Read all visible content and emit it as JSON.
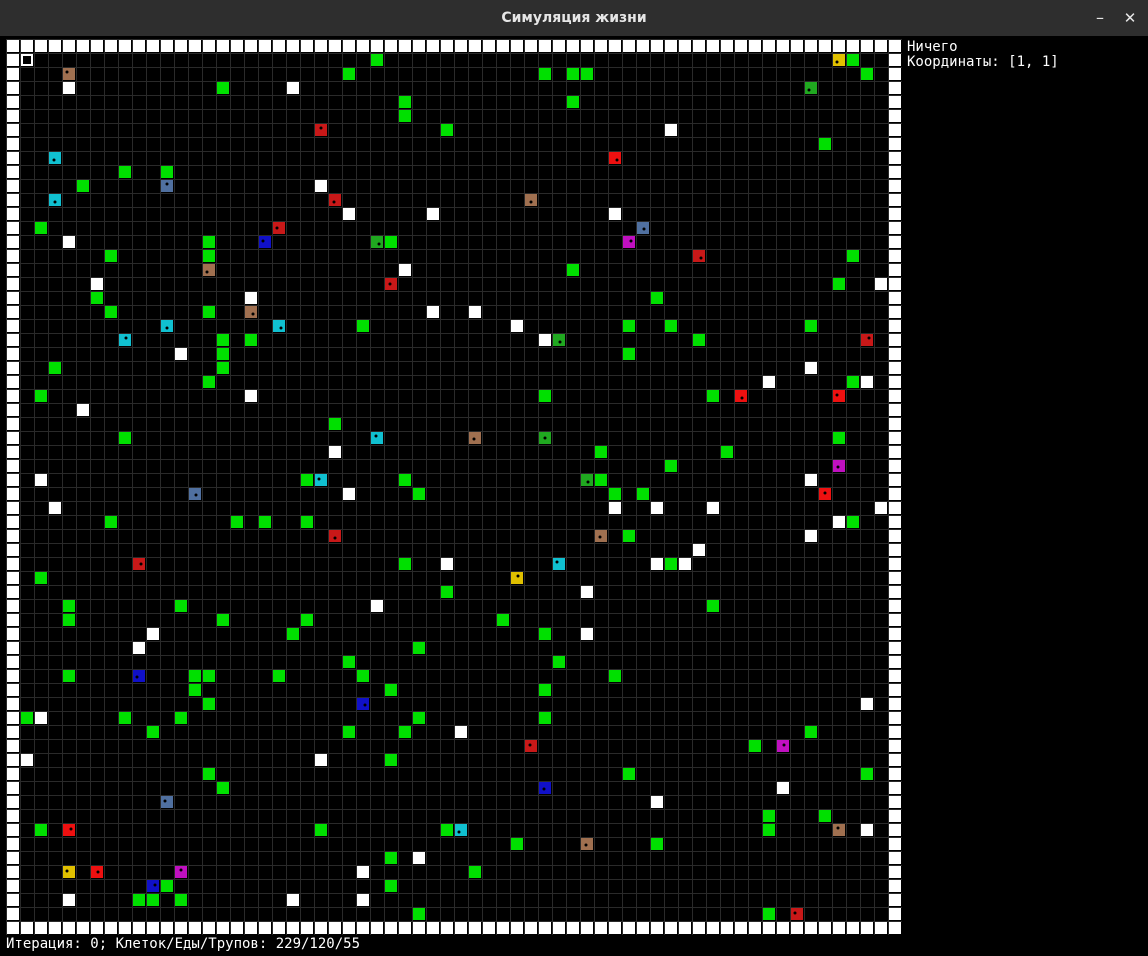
{
  "window": {
    "title": "Симуляция жизни",
    "minimize_glyph": "–",
    "close_glyph": "✕"
  },
  "info": {
    "cell_label": "Ничего",
    "coordinates_label": "Координаты: [1, 1]"
  },
  "status": {
    "text": "Итерация: 0; Клеток/Еды/Трупов: 229/120/55"
  },
  "board": {
    "cols": 64,
    "rows": 64,
    "selected_cell": [
      1,
      1
    ],
    "colors": {
      "background": "#000000",
      "gridline": "#2a2a2a",
      "wall": "#ffffff",
      "food": "#00e000",
      "corpse": "#ffffff",
      "red": "#ee1010",
      "darkred": "#c81818",
      "green": "#20a820",
      "blue": "#1010c8",
      "cyan": "#10c0d0",
      "yellow": "#e0c000",
      "brown": "#a07050",
      "magenta": "#c010c0",
      "slate": "#5070a0",
      "cell_dot": "#000000"
    }
  }
}
